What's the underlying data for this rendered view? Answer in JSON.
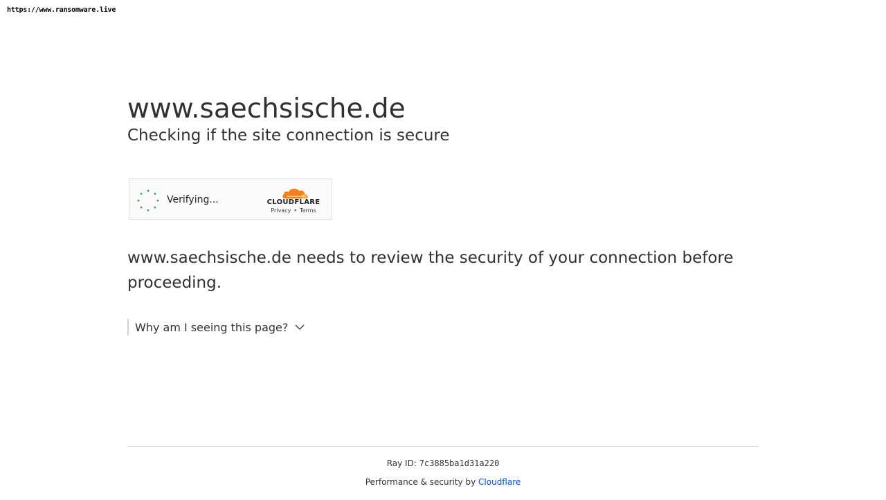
{
  "watermark": "https://www.ransomware.live",
  "site": {
    "title": "www.saechsische.de",
    "subtitle": "Checking if the site connection is secure"
  },
  "widget": {
    "status": "Verifying...",
    "brand": "CLOUDFLARE",
    "privacy": "Privacy",
    "separator": "•",
    "terms": "Terms",
    "spinner_color": "#2ea44f",
    "cloud_color": "#f38020"
  },
  "review_text": "www.saechsische.de needs to review the security of your connection before proceeding.",
  "why_label": "Why am I seeing this page?",
  "footer": {
    "ray_label": "Ray ID:",
    "ray_id": "7c3885ba1d31a220",
    "perf_label": "Performance & security by",
    "perf_link": "Cloudflare",
    "link_color": "#0051c3"
  }
}
